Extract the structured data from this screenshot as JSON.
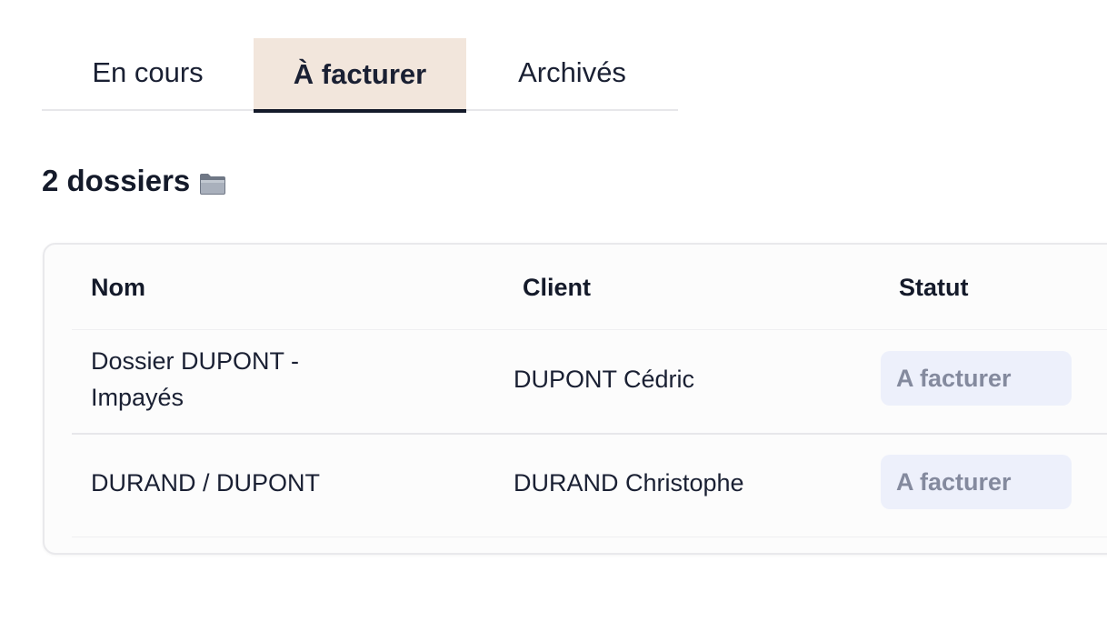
{
  "tabs": [
    {
      "label": "En cours"
    },
    {
      "label": "À facturer"
    },
    {
      "label": "Archivés"
    }
  ],
  "active_tab": "À facturer",
  "heading": {
    "count_label": "2 dossiers",
    "icon": "folder-icon"
  },
  "table": {
    "columns": [
      "Nom",
      "Client",
      "Statut"
    ],
    "rows": [
      {
        "nom": "Dossier DUPONT - Impayés",
        "client": "DUPONT Cédric",
        "statut": "A facturer"
      },
      {
        "nom": "DURAND / DUPONT",
        "client": "DURAND Christophe",
        "statut": "A facturer"
      }
    ]
  },
  "colors": {
    "active_tab_bg": "#f2e6dc",
    "active_tab_underline": "#141a2a",
    "badge_bg": "#edf0fb",
    "badge_text": "#848a9e"
  }
}
